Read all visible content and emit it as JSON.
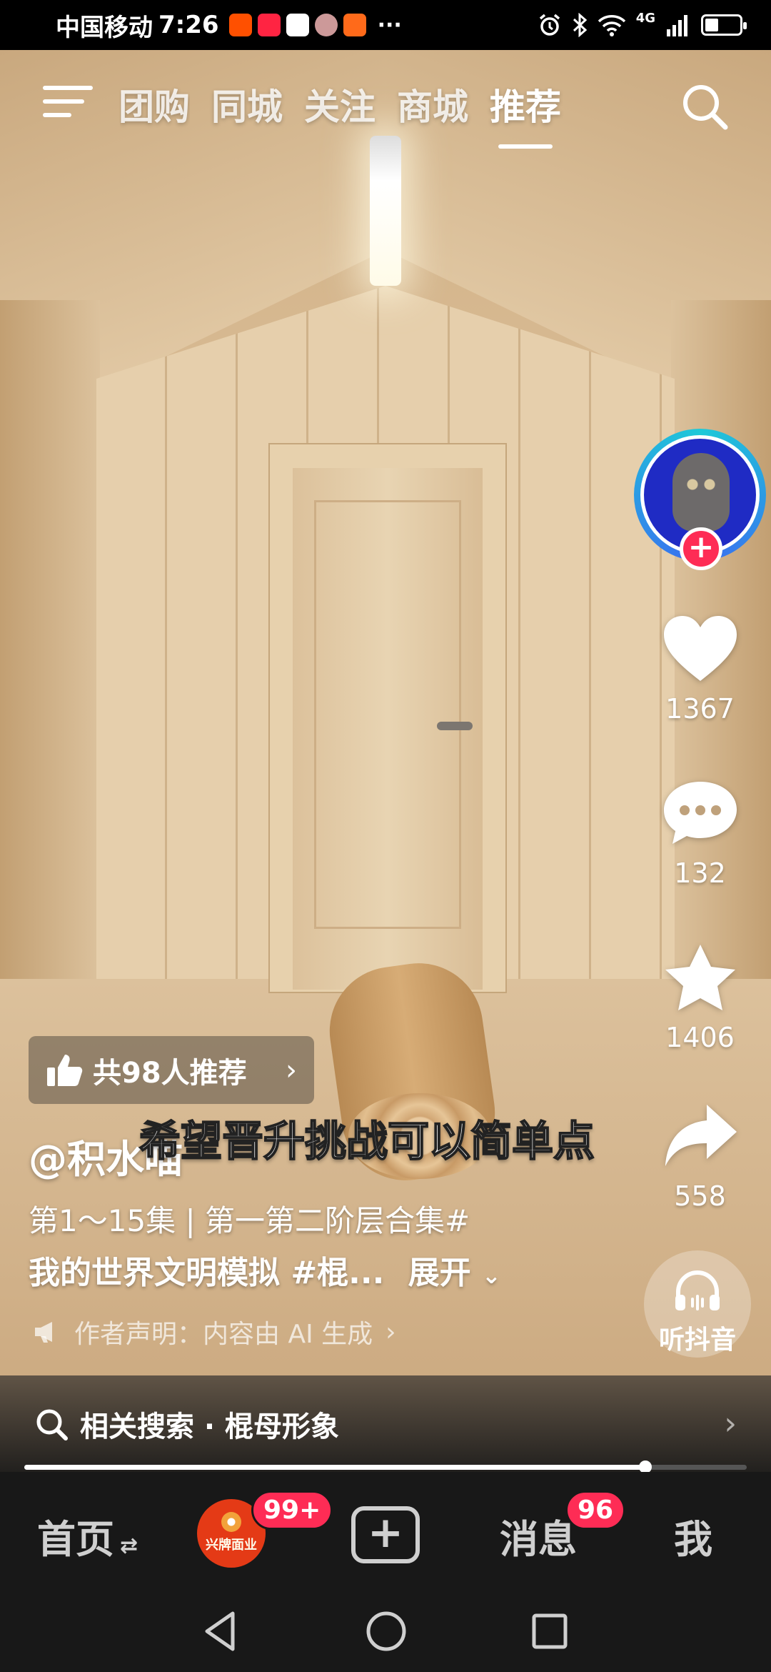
{
  "status_bar": {
    "carrier": "中国移动",
    "time": "7:26",
    "app_icons": [
      "taobao-icon",
      "xiaohongshu-icon",
      "shield-icon",
      "avatar-icon",
      "game-icon"
    ],
    "overflow": "···",
    "network": "4G",
    "icons": [
      "alarm-icon",
      "bluetooth-icon",
      "wifi-icon",
      "signal-icon",
      "battery-icon"
    ]
  },
  "top_nav": {
    "tabs": [
      {
        "label": "团购",
        "active": false
      },
      {
        "label": "同城",
        "active": false
      },
      {
        "label": "关注",
        "active": false
      },
      {
        "label": "商城",
        "active": false
      },
      {
        "label": "推荐",
        "active": true
      }
    ]
  },
  "video": {
    "subtitle": "希望晋升挑战可以简单点",
    "recommend": "共98人推荐",
    "author": "@积水喵",
    "description_line1": "第1～15集 | 第一第二阶层合集#",
    "description_line2": "我的世界文明模拟 #棍...",
    "expand": "展开",
    "ai_note": "作者声明：内容由 AI 生成",
    "listen": "听抖音",
    "progress": 0.86
  },
  "actions": {
    "likes": "1367",
    "comments": "132",
    "favorites": "1406",
    "shares": "558"
  },
  "related_search": {
    "label": "相关搜索 · 棍母形象"
  },
  "bottom_nav": {
    "home": "首页",
    "shop_badge": "99+",
    "shop_logo_text": "兴牌面业",
    "messages": "消息",
    "messages_badge": "96",
    "me": "我"
  },
  "colors": {
    "accent": "#fe2c55",
    "avatar_ring": "#1ec9d8",
    "nav_bg": "#181818"
  }
}
